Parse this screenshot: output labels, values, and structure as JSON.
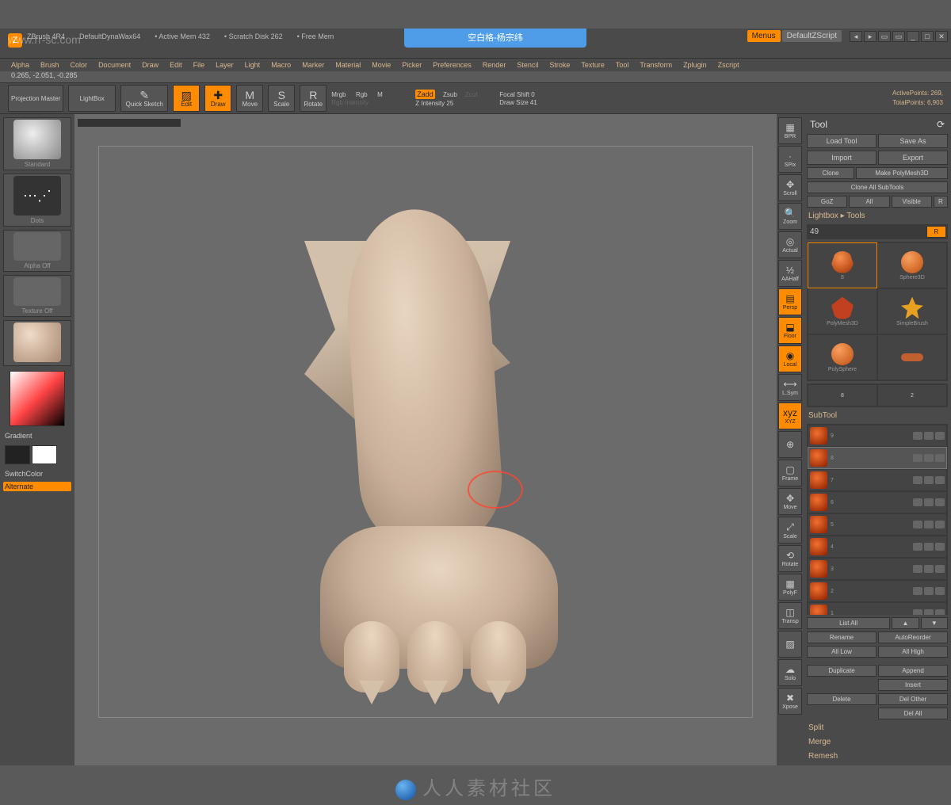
{
  "watermark": "www.rr-sc.com",
  "bottom_watermark": "人人素材社区",
  "titlebar": {
    "app": "ZBrush 4R4",
    "doc": "DefaultDynaWax64",
    "mem": "Active Mem 432",
    "scratch": "Scratch Disk 262",
    "free": "Free Mem",
    "overlay": "空白格-杨宗纬",
    "menus_btn": "Menus",
    "script_btn": "DefaultZScript"
  },
  "menu": [
    "Alpha",
    "Brush",
    "Color",
    "Document",
    "Draw",
    "Edit",
    "File",
    "Layer",
    "Light",
    "Macro",
    "Marker",
    "Material",
    "Movie",
    "Picker",
    "Preferences",
    "Render",
    "Stencil",
    "Stroke",
    "Texture",
    "Tool",
    "Transform",
    "Zplugin",
    "Zscript"
  ],
  "coords": "0.265, -2.051, -0.285",
  "toolbar": {
    "projection": "Projection Master",
    "lightbox": "LightBox",
    "quicksketch": "Quick Sketch",
    "edit": "Edit",
    "draw": "Draw",
    "move": "Move",
    "scale": "Scale",
    "rotate": "Rotate",
    "mrgb": "Mrgb",
    "rgb": "Rgb",
    "m": "M",
    "rgb_int": "Rgb Intensity",
    "zadd": "Zadd",
    "zsub": "Zsub",
    "zcut": "Zcut",
    "zint": "Z Intensity 25",
    "focal": "Focal Shift 0",
    "drawsize": "Draw Size 41",
    "active_pts": "ActivePoints: 269,",
    "total_pts": "TotalPoints: 6,903"
  },
  "left": {
    "brush": "Standard",
    "stroke": "Dots",
    "alpha": "Alpha Off",
    "texture": "Texture Off",
    "material": "",
    "gradient": "Gradient",
    "switch": "SwitchColor",
    "alternate": "Alternate"
  },
  "rside": [
    "BPR",
    "SPix",
    "Scroll",
    "Zoom",
    "Actual",
    "AAHalf",
    "Persp",
    "Floor",
    "Local",
    "L.Sym",
    "XYZ",
    "",
    "Frame",
    "Move",
    "Scale",
    "Rotate",
    "PolyF",
    "Transp",
    "",
    "Solo",
    "Xpose"
  ],
  "rside_orange": [
    6,
    7,
    8,
    10
  ],
  "tool": {
    "header": "Tool",
    "load": "Load Tool",
    "save": "Save As",
    "import": "Import",
    "export": "Export",
    "clone": "Clone",
    "makepoly": "Make PolyMesh3D",
    "cloneall": "Clone All SubTools",
    "goz": "GoZ",
    "all": "All",
    "visible": "Visible",
    "r": "R",
    "lightbox": "Lightbox ▸ Tools",
    "grid_num": "49",
    "grid_r": "R",
    "tools": [
      {
        "n": "8",
        "lbl": ""
      },
      {
        "n": "",
        "lbl": "Sphere3D"
      },
      {
        "n": "",
        "lbl": "PolyMesh3D"
      },
      {
        "n": "",
        "lbl": "SimpleBrush"
      }
    ],
    "tools2": [
      {
        "n": "8"
      },
      {
        "n": "",
        "lbl": "PolySphere"
      }
    ],
    "toolrow": [
      {
        "n": "8"
      },
      {
        "n": "2"
      }
    ],
    "subtool_h": "SubTool",
    "subtools": [
      {
        "num": "9"
      },
      {
        "num": "8"
      },
      {
        "num": "7"
      },
      {
        "num": "6"
      },
      {
        "num": "5"
      },
      {
        "num": "4"
      },
      {
        "num": "3"
      },
      {
        "num": "2"
      },
      {
        "num": "1"
      }
    ],
    "listall": "List All",
    "rename": "Rename",
    "autoreorder": "AutoReorder",
    "alllow": "All Low",
    "allhigh": "All High",
    "duplicate": "Duplicate",
    "append": "Append",
    "insert": "Insert",
    "delete": "Delete",
    "delother": "Del Other",
    "delall": "Del All",
    "split": "Split",
    "merge": "Merge",
    "remesh": "Remesh"
  }
}
